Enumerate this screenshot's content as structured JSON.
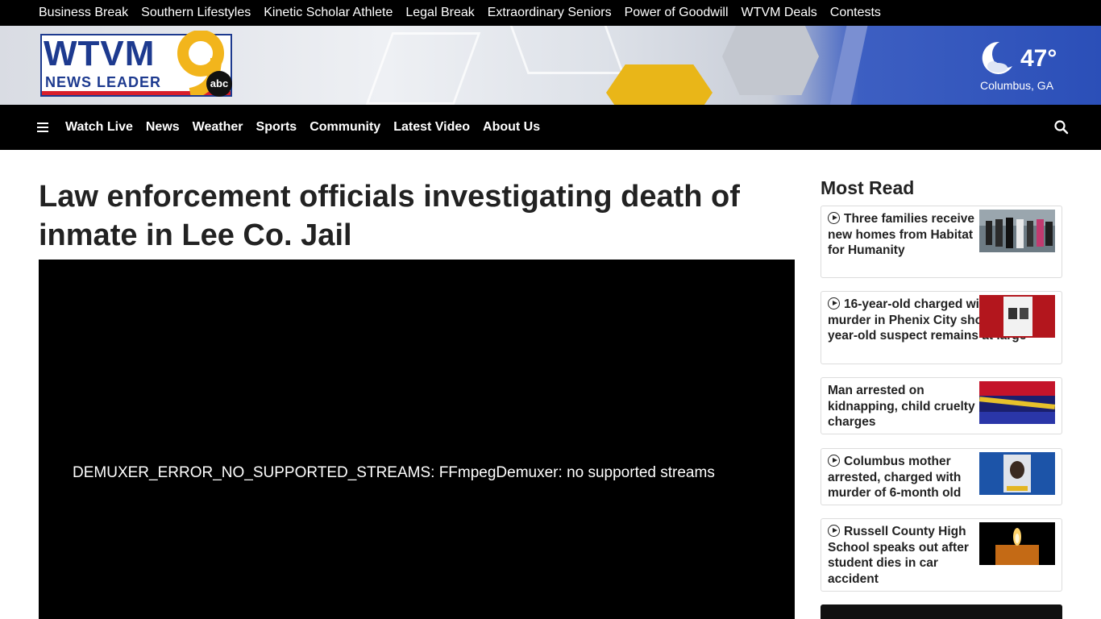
{
  "top_links": [
    "Business Break",
    "Southern Lifestyles",
    "Kinetic Scholar Athlete",
    "Legal Break",
    "Extraordinary Seniors",
    "Power of Goodwill",
    "WTVM Deals",
    "Contests"
  ],
  "logo": {
    "call_letters": "WTVM",
    "tagline": "NEWS LEADER",
    "channel": "9",
    "network": "abc"
  },
  "weather": {
    "temperature": "47°",
    "location": "Columbus, GA",
    "icon": "moon-cloud-icon"
  },
  "nav": {
    "items": [
      "Watch Live",
      "News",
      "Weather",
      "Sports",
      "Community",
      "Latest Video",
      "About Us"
    ],
    "menu_icon": "hamburger-icon",
    "search_icon": "search-icon"
  },
  "article": {
    "headline": "Law enforcement officials investigating death of inmate in Lee Co. Jail",
    "video_error": "DEMUXER_ERROR_NO_SUPPORTED_STREAMS: FFmpegDemuxer: no supported streams"
  },
  "sidebar": {
    "title": "Most Read",
    "items": [
      {
        "title": "Three families receive new homes from Habitat for Humanity",
        "video": true
      },
      {
        "title": "16-year-old charged with Capital murder in Phenix City shooting, 13-year-old suspect remains at large",
        "video": true
      },
      {
        "title": "Man arrested on kidnapping, child cruelty charges",
        "video": false
      },
      {
        "title": "Columbus mother arrested, charged with murder of 6-month old",
        "video": true
      },
      {
        "title": "Russell County High School speaks out after student dies in car accident",
        "video": true
      }
    ]
  },
  "colors": {
    "brand_blue": "#1d3a8f",
    "brand_gold": "#f2b51c",
    "brand_red": "#d81e2b",
    "nav_bg": "#000000"
  }
}
